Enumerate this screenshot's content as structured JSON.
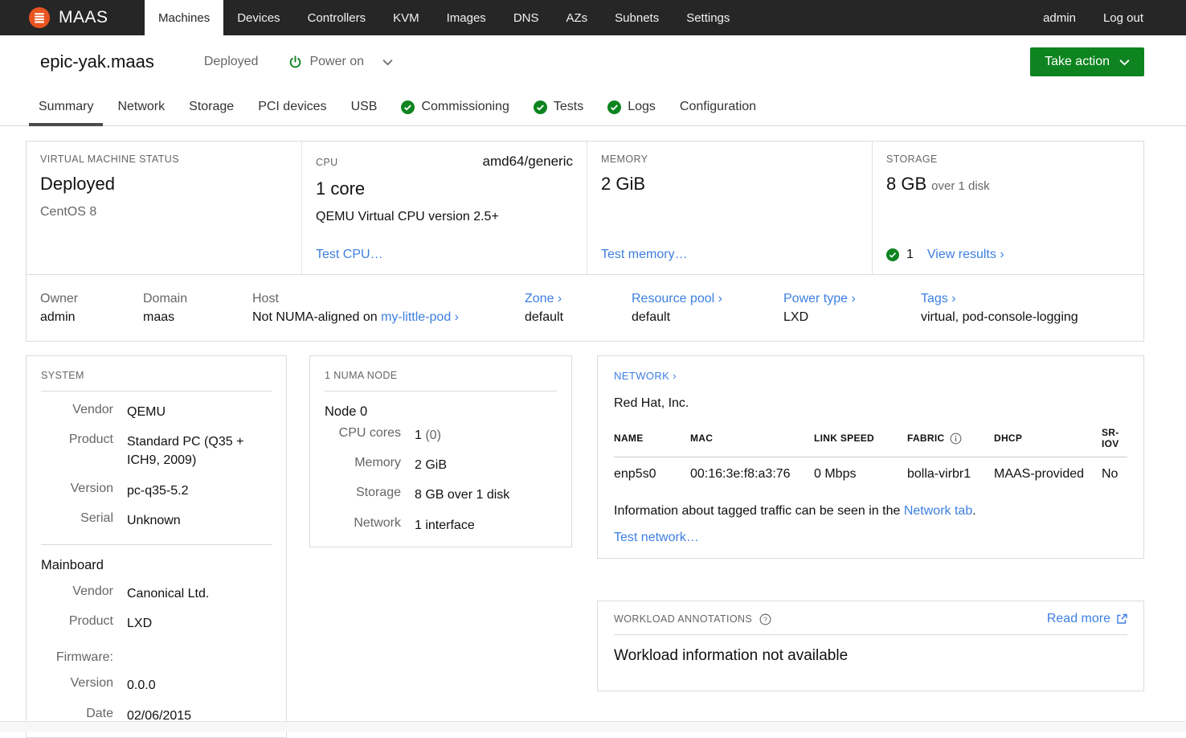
{
  "colors": {
    "accent": "#e95420",
    "green": "#0e8420",
    "link": "#3d7fe0",
    "nav_bg": "#262626"
  },
  "nav": {
    "brand": "MAAS",
    "items": [
      "Machines",
      "Devices",
      "Controllers",
      "KVM",
      "Images",
      "DNS",
      "AZs",
      "Subnets",
      "Settings"
    ],
    "active": "Machines",
    "user": "admin",
    "logout": "Log out"
  },
  "header": {
    "title": "epic-yak.maas",
    "status": "Deployed",
    "power": "Power on",
    "take_action": "Take action"
  },
  "tabs": {
    "items": [
      "Summary",
      "Network",
      "Storage",
      "PCI devices",
      "USB",
      "Commissioning",
      "Tests",
      "Logs",
      "Configuration"
    ],
    "active": "Summary"
  },
  "overview": {
    "vm_status_label": "VIRTUAL MACHINE STATUS",
    "vm_status": "Deployed",
    "vm_os": "CentOS 8",
    "cpu_label": "CPU",
    "cpu_arch": "amd64/generic",
    "cpu_value": "1 core",
    "cpu_model": "QEMU Virtual CPU version 2.5+",
    "cpu_action": "Test CPU…",
    "memory_label": "MEMORY",
    "memory_value": "2 GiB",
    "memory_action": "Test memory…",
    "storage_label": "STORAGE",
    "storage_value": "8 GB",
    "storage_sub": "over 1 disk",
    "storage_count": "1",
    "storage_action": "View results ›"
  },
  "meta": {
    "owner_label": "Owner",
    "owner": "admin",
    "domain_label": "Domain",
    "domain": "maas",
    "host_label": "Host",
    "host_text": "Not NUMA-aligned on ",
    "host_link": "my-little-pod ›",
    "zone_label": "Zone ›",
    "zone": "default",
    "pool_label": "Resource pool ›",
    "pool": "default",
    "power_label": "Power type ›",
    "power": "LXD",
    "tags_label": "Tags ›",
    "tags": "virtual, pod-console-logging"
  },
  "system": {
    "title": "SYSTEM",
    "vendor_label": "Vendor",
    "vendor": "QEMU",
    "product_label": "Product",
    "product": "Standard PC (Q35 + ICH9, 2009)",
    "version_label": "Version",
    "version": "pc-q35-5.2",
    "serial_label": "Serial",
    "serial": "Unknown",
    "mainboard_title": "Mainboard",
    "mb_vendor_label": "Vendor",
    "mb_vendor": "Canonical Ltd.",
    "mb_product_label": "Product",
    "mb_product": "LXD",
    "firmware_label": "Firmware:",
    "fw_version_label": "Version",
    "fw_version": "0.0.0",
    "fw_date_label": "Date",
    "fw_date": "02/06/2015"
  },
  "numa": {
    "title": "1 NUMA NODE",
    "node": "Node 0",
    "cores_label": "CPU cores",
    "cores": "1",
    "cores_muted": " (0)",
    "memory_label": "Memory",
    "memory": "2 GiB",
    "storage_label": "Storage",
    "storage": "8 GB over 1 disk",
    "network_label": "Network",
    "network": "1 interface"
  },
  "network": {
    "title": "NETWORK ›",
    "vendor": "Red Hat, Inc.",
    "columns": [
      "NAME",
      "MAC",
      "LINK SPEED",
      "FABRIC",
      "DHCP",
      "SR-IOV"
    ],
    "row": {
      "name": "enp5s0",
      "mac": "00:16:3e:f8:a3:76",
      "link_speed": "0 Mbps",
      "fabric": "bolla-virbr1",
      "dhcp": "MAAS-provided",
      "sriov": "No"
    },
    "info_text": "Information about tagged traffic can be seen in the ",
    "info_link": "Network tab",
    "info_suffix": ".",
    "action": "Test network…"
  },
  "workload": {
    "title": "WORKLOAD ANNOTATIONS",
    "read_more": "Read more",
    "message": "Workload information not available"
  }
}
